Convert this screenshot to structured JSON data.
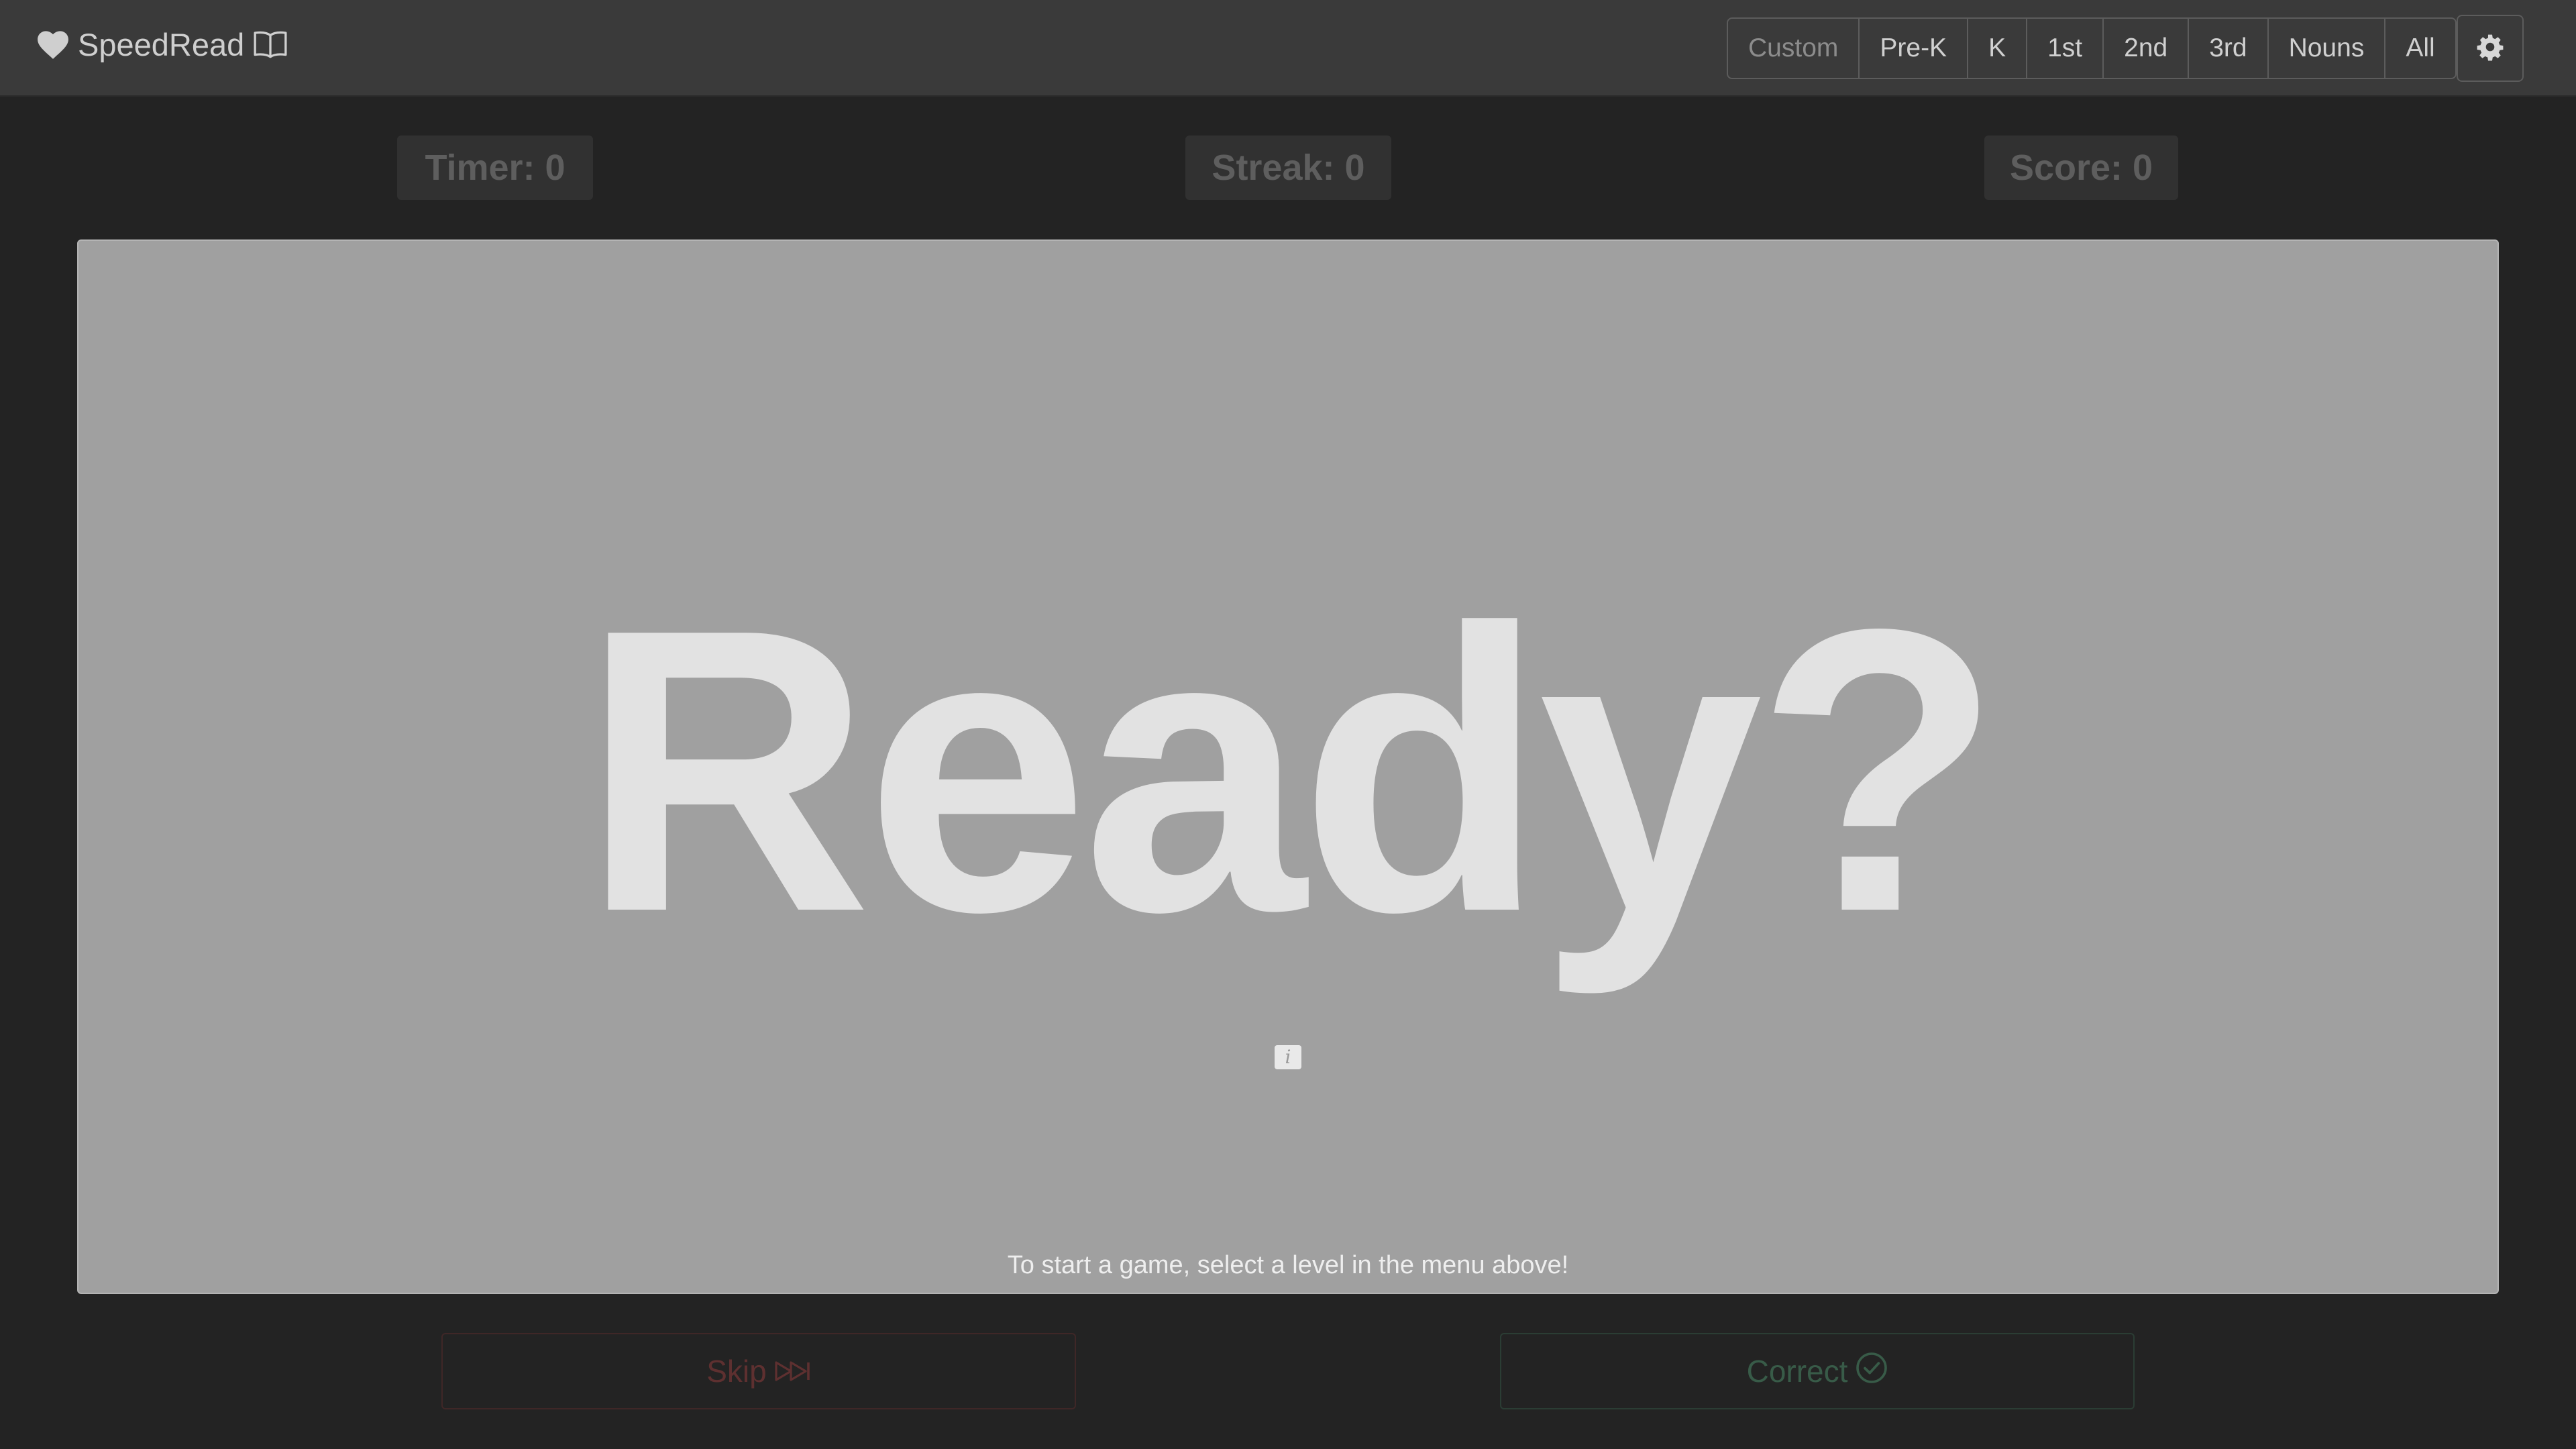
{
  "app": {
    "title": "SpeedRead"
  },
  "levels": [
    "Custom",
    "Pre-K",
    "K",
    "1st",
    "2nd",
    "3rd",
    "Nouns",
    "All"
  ],
  "stats": {
    "timer": "Timer: 0",
    "streak": "Streak: 0",
    "score": "Score: 0"
  },
  "card": {
    "word": "Ready?",
    "hint": "To start a game, select a level in the menu above!",
    "info_icon_label": "i"
  },
  "actions": {
    "skip_label": "Skip",
    "correct_label": "Correct"
  },
  "icons": {
    "brand_left": "heart-icon",
    "brand_right": "book-open-icon",
    "settings": "gear-icon",
    "skip": "fast-forward-icon",
    "correct": "check-circle-icon",
    "info": "info-icon"
  },
  "colors": {
    "page_bg": "#232323",
    "navbar_bg": "#3a3a3a",
    "card_bg": "#a0a0a0",
    "word_color": "#e2e2e2",
    "skip_color": "#5e3030",
    "correct_color": "#385b48"
  }
}
